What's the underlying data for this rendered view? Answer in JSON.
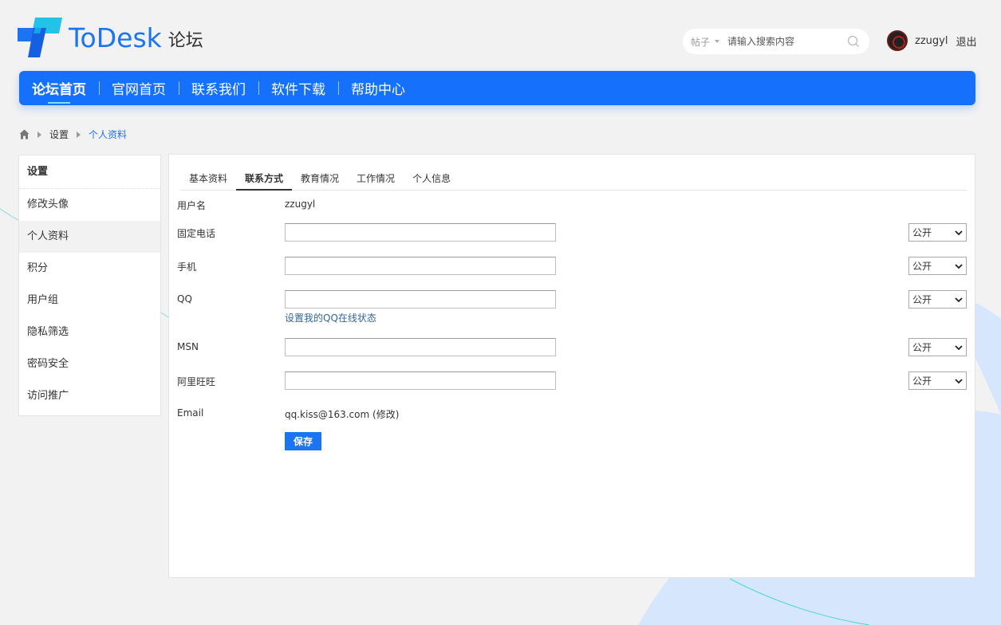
{
  "header": {
    "logo_text": "ToDesk",
    "logo_sub": "论坛",
    "search": {
      "type_label": "帖子",
      "placeholder": "请输入搜索内容"
    },
    "user": {
      "name": "zzugyl",
      "logout_label": "退出"
    }
  },
  "nav": {
    "items": [
      {
        "label": "论坛首页"
      },
      {
        "label": "官网首页"
      },
      {
        "label": "联系我们"
      },
      {
        "label": "软件下载"
      },
      {
        "label": "帮助中心"
      }
    ]
  },
  "breadcrumb": {
    "items": [
      "设置",
      "个人资料"
    ]
  },
  "sidebar": {
    "title": "设置",
    "items": [
      {
        "label": "修改头像"
      },
      {
        "label": "个人资料"
      },
      {
        "label": "积分"
      },
      {
        "label": "用户组"
      },
      {
        "label": "隐私筛选"
      },
      {
        "label": "密码安全"
      },
      {
        "label": "访问推广"
      }
    ]
  },
  "tabs": [
    {
      "label": "基本资料"
    },
    {
      "label": "联系方式"
    },
    {
      "label": "教育情况"
    },
    {
      "label": "工作情况"
    },
    {
      "label": "个人信息"
    }
  ],
  "form": {
    "username_label": "用户名",
    "username_value": "zzugyl",
    "phone_label": "固定电话",
    "mobile_label": "手机",
    "qq_label": "QQ",
    "qq_link": "设置我的QQ在线状态",
    "msn_label": "MSN",
    "wangwang_label": "阿里旺旺",
    "email_label": "Email",
    "email_value": "qq.kiss@163.com",
    "email_edit": "(修改)",
    "privacy_value": "公开",
    "save_label": "保存"
  },
  "colors": {
    "brand": "#1b74f2",
    "nav": "#1570fb",
    "link": "#336699"
  }
}
